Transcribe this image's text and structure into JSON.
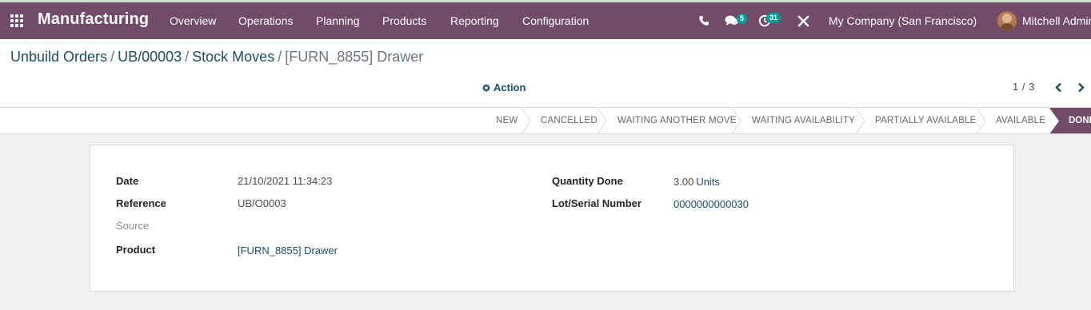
{
  "topbar": {
    "app_name": "Manufacturing",
    "menu": [
      "Overview",
      "Operations",
      "Planning",
      "Products",
      "Reporting",
      "Configuration"
    ],
    "messages_count": "5",
    "activities_count": "31",
    "company": "My Company (San Francisco)",
    "user": "Mitchell Admin",
    "colors": {
      "bar": "#714b67",
      "badge": "#00a09d"
    }
  },
  "breadcrumb": {
    "items": [
      "Unbuild Orders",
      "UB/00003",
      "Stock Moves"
    ],
    "current": "[FURN_8855] Drawer",
    "separator": "/"
  },
  "toolbar": {
    "action_label": "Action",
    "pager_value": "1 / 3"
  },
  "statusbar": {
    "stages": [
      "NEW",
      "CANCELLED",
      "WAITING ANOTHER MOVE",
      "WAITING AVAILABILITY",
      "PARTIALLY AVAILABLE",
      "AVAILABLE"
    ],
    "active_stage": "DONE"
  },
  "form": {
    "left": [
      {
        "label": "Date",
        "value": "21/10/2021 11:34:23"
      },
      {
        "label": "Reference",
        "value": "UB/O0003"
      },
      {
        "label": "Source",
        "value": ""
      },
      {
        "label": "Product",
        "value": "[FURN_8855] Drawer"
      }
    ],
    "right": [
      {
        "label": "Quantity Done",
        "value": "3.00",
        "unit": "Units"
      },
      {
        "label": "Lot/Serial Number",
        "value": "0000000000030"
      }
    ]
  }
}
